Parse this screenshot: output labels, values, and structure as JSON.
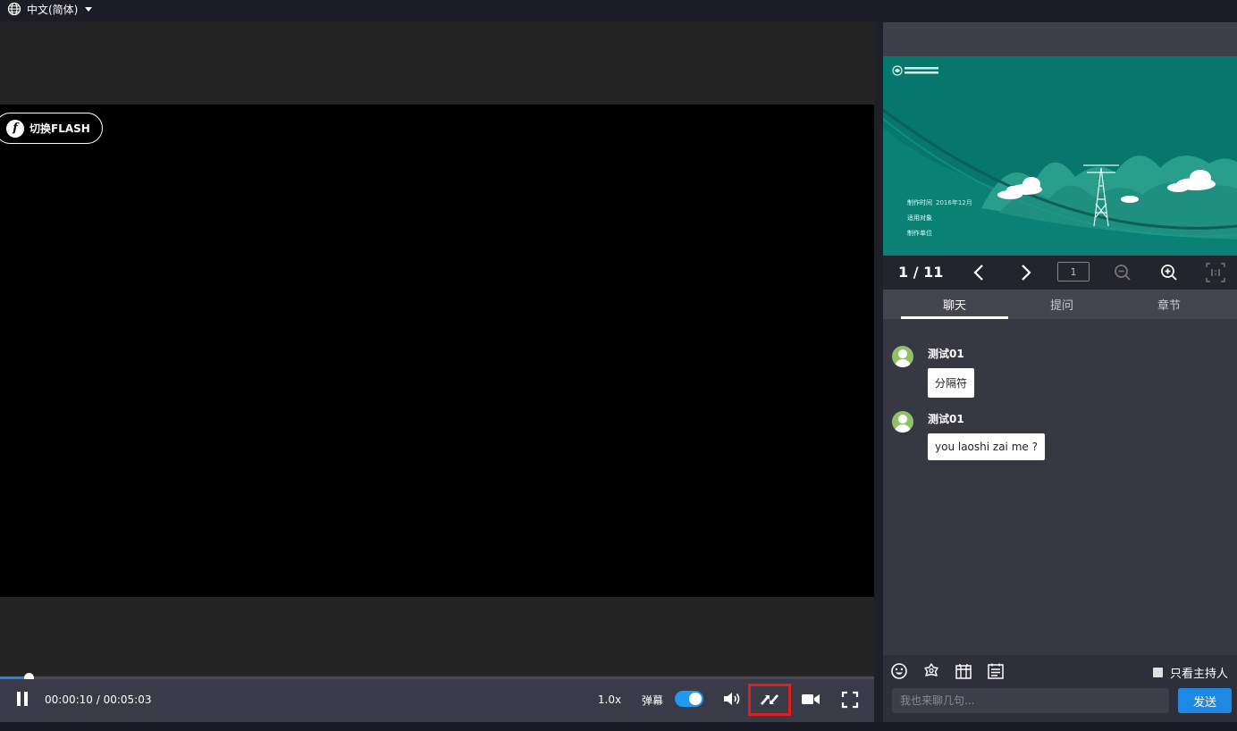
{
  "language": {
    "label": "中文(简体)",
    "icon": "globe-icon"
  },
  "player": {
    "flash_button": "切换FLASH",
    "time": "00:00:10 / 00:05:03",
    "progress_fraction": 0.033,
    "speed": "1.0x",
    "danmu_label": "弹幕",
    "danmu_enabled": true,
    "icons": [
      "pause-icon",
      "volume-icon",
      "switch-layout-icon",
      "camera-icon",
      "fullscreen-icon"
    ]
  },
  "slides": {
    "page_indicator": "1 / 11",
    "page_input": "1",
    "slide_lines": [
      {
        "label": "制作时间",
        "value": "2016年12月"
      },
      {
        "label": "适用对象",
        "value": ""
      },
      {
        "label": "制作单位",
        "value": ""
      }
    ]
  },
  "tabs": [
    "聊天",
    "提问",
    "章节"
  ],
  "active_tab": "聊天",
  "messages": [
    {
      "user": "测试01",
      "text": "分隔符"
    },
    {
      "user": "测试01",
      "text": "you laoshi zai me ?"
    }
  ],
  "toolbar": {
    "icons": [
      "emoji-icon",
      "flower-icon",
      "calendar-icon",
      "notice-icon"
    ],
    "host_only_label": "只看主持人"
  },
  "composer": {
    "placeholder": "我也来聊几句...",
    "send_label": "发送"
  },
  "colors": {
    "accent": "#1e88e5",
    "highlight": "#e02020",
    "slide_bg": "#07766c"
  }
}
